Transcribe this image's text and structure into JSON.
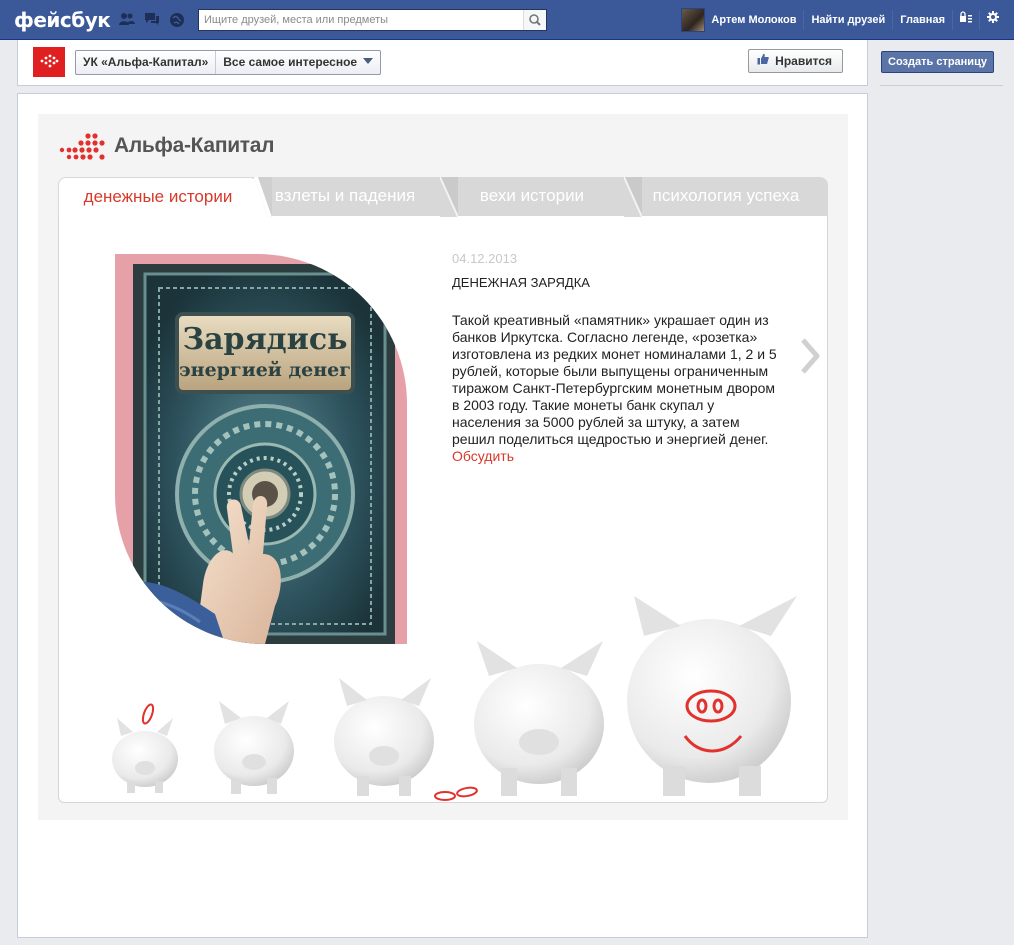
{
  "topbar": {
    "logo": "фейсбук",
    "search_placeholder": "Ищите друзей, места или предметы",
    "user_name": "Артем Молоков",
    "find_friends": "Найти друзей",
    "home": "Главная"
  },
  "page": {
    "crumb_page": "УК «Альфа-Капитал»",
    "crumb_filter": "Все самое интересное",
    "like_label": "Нравится"
  },
  "sidebar": {
    "create_page": "Создать страницу"
  },
  "app": {
    "brand_name": "Альфа-Капитал",
    "tabs": [
      {
        "label": "денежные истории",
        "active": true
      },
      {
        "label": "взлеты и падения",
        "active": false
      },
      {
        "label": "вехи истории",
        "active": false
      },
      {
        "label": "психология успеха",
        "active": false
      }
    ],
    "post": {
      "date": "04.12.2013",
      "title": "ДЕНЕЖНАЯ ЗАРЯДКА",
      "body": "Такой креативный «памятник» украшает один из банков Иркутска. Согласно легенде, «розетка» изготовлена из редких монет номиналами 1, 2 и 5 рублей, которые были выпущены ограниченным тиражом Санкт-Петербургским монетным двором в 2003 году. Такие монеты банк скупал у населения за 5000 рублей за штуку, а затем решил поделиться щедростью и энергией денег.",
      "link": "Обсудить"
    },
    "photo_text": {
      "line1": "Зарядись",
      "line2": "энергией денег"
    }
  },
  "colors": {
    "facebook_blue": "#3b5998",
    "brand_red": "#d7392b",
    "tab_gray": "#d8d8d8"
  },
  "icons": [
    "friend-requests-icon",
    "messages-icon",
    "notifications-icon",
    "search-icon",
    "privacy-icon",
    "settings-icon",
    "like-thumb-icon",
    "next-arrow-icon",
    "brand-dots-logo"
  ]
}
